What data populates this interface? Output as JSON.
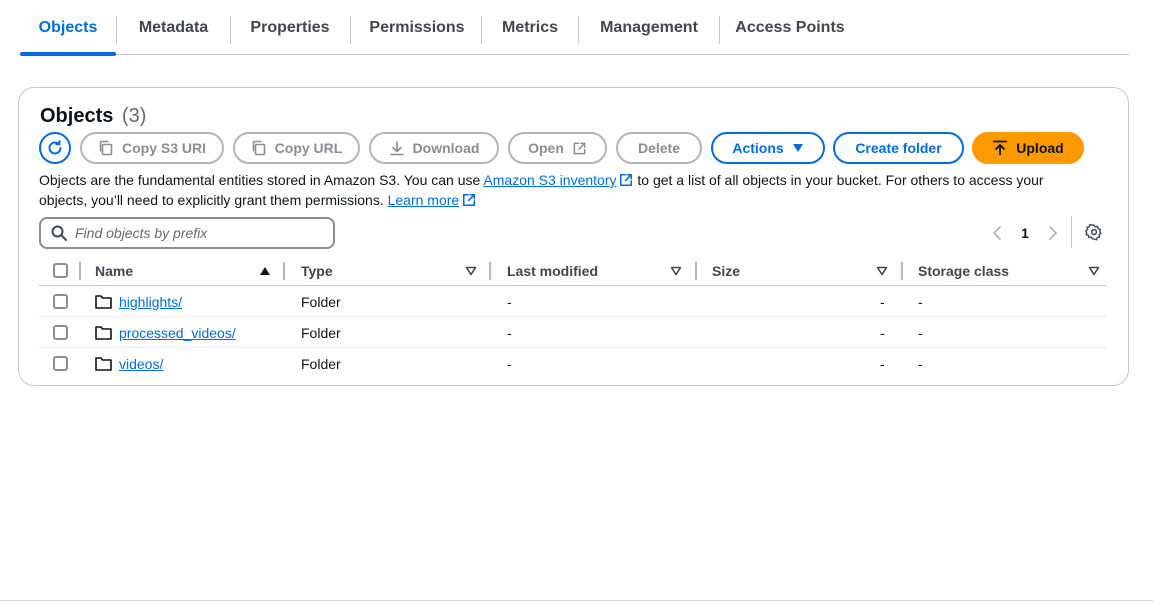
{
  "tabs": [
    {
      "label": "Objects",
      "active": true
    },
    {
      "label": "Metadata",
      "active": false
    },
    {
      "label": "Properties",
      "active": false
    },
    {
      "label": "Permissions",
      "active": false
    },
    {
      "label": "Metrics",
      "active": false
    },
    {
      "label": "Management",
      "active": false
    },
    {
      "label": "Access Points",
      "active": false
    }
  ],
  "panel": {
    "title": "Objects",
    "count": "(3)"
  },
  "toolbar": {
    "refresh_icon": "refresh-icon",
    "copy_s3_uri": "Copy S3 URI",
    "copy_url": "Copy URL",
    "download": "Download",
    "open": "Open",
    "delete": "Delete",
    "actions": "Actions",
    "create_folder": "Create folder",
    "upload": "Upload"
  },
  "description": {
    "part1": "Objects are the fundamental entities stored in Amazon S3. You can use ",
    "inventory_link": "Amazon S3 inventory",
    "part2": " to get a list of all objects in your bucket. For others to access your objects, you’ll need to explicitly grant them permissions. ",
    "learn_more": "Learn more"
  },
  "search": {
    "placeholder": "Find objects by prefix",
    "value": ""
  },
  "pagination": {
    "current_page": "1"
  },
  "table": {
    "columns": [
      "Name",
      "Type",
      "Last modified",
      "Size",
      "Storage class"
    ],
    "rows": [
      {
        "name": "highlights/",
        "type": "Folder",
        "last_modified": "-",
        "size": "-",
        "storage_class": "-"
      },
      {
        "name": "processed_videos/",
        "type": "Folder",
        "last_modified": "-",
        "size": "-",
        "storage_class": "-"
      },
      {
        "name": "videos/",
        "type": "Folder",
        "last_modified": "-",
        "size": "-",
        "storage_class": "-"
      }
    ]
  },
  "colors": {
    "accent": "#006ce0",
    "upload": "#ff9900",
    "disabled": "#8c8c94"
  }
}
